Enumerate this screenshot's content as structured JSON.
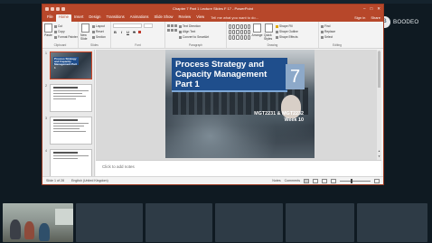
{
  "meeting": {
    "presenter_name": "BOODEO",
    "presenter_initials": "B"
  },
  "window": {
    "title": "Chapter 7 Part 1 Lecture Slides F 17 - PowerPoint",
    "controls": [
      "–",
      "□",
      "✕"
    ]
  },
  "ribbon": {
    "tabs": [
      "File",
      "Home",
      "Insert",
      "Design",
      "Transitions",
      "Animations",
      "Slide Show",
      "Review",
      "View"
    ],
    "active_tab": "Home",
    "tell_me": "Tell me what you want to do...",
    "sign_in": "Sign in",
    "share": "Share",
    "clipboard": {
      "paste": "Paste",
      "cut": "Cut",
      "copy": "Copy",
      "format_painter": "Format Painter",
      "label": "Clipboard"
    },
    "slides": {
      "new_slide": "New Slide",
      "layout": "Layout",
      "reset": "Reset",
      "section": "Section",
      "label": "Slides"
    },
    "font": {
      "font_name": "",
      "font_size": "",
      "bold": "B",
      "italic": "I",
      "underline": "U",
      "strike": "S",
      "label": "Font"
    },
    "paragraph": {
      "label": "Paragraph",
      "text_direction": "Text Direction",
      "align_text": "Align Text",
      "smartart": "Convert to SmartArt"
    },
    "drawing": {
      "arrange": "Arrange",
      "quick_styles": "Quick Styles",
      "shape_fill": "Shape Fill",
      "shape_outline": "Shape Outline",
      "shape_effects": "Shape Effects",
      "label": "Drawing"
    },
    "editing": {
      "find": "Find",
      "replace": "Replace",
      "select": "Select",
      "label": "Editing"
    }
  },
  "thumbnails": [
    {
      "number": "1",
      "title": "Process Strategy and Capacity Management Part 1"
    },
    {
      "number": "2",
      "title": ""
    },
    {
      "number": "3",
      "title": ""
    },
    {
      "number": "4",
      "title": ""
    }
  ],
  "slide": {
    "title": "Process Strategy and Capacity Management Part 1",
    "chapter_number": "7",
    "course_code": "MGT2231 & MGT2232",
    "week": "Week 10"
  },
  "notes": {
    "placeholder": "Click to add notes"
  },
  "status": {
    "slide_indicator": "Slide 1 of 28",
    "language": "English (United Kingdom)",
    "notes_btn": "Notes",
    "comments_btn": "Comments"
  },
  "participants": {
    "tile_count": 6
  }
}
